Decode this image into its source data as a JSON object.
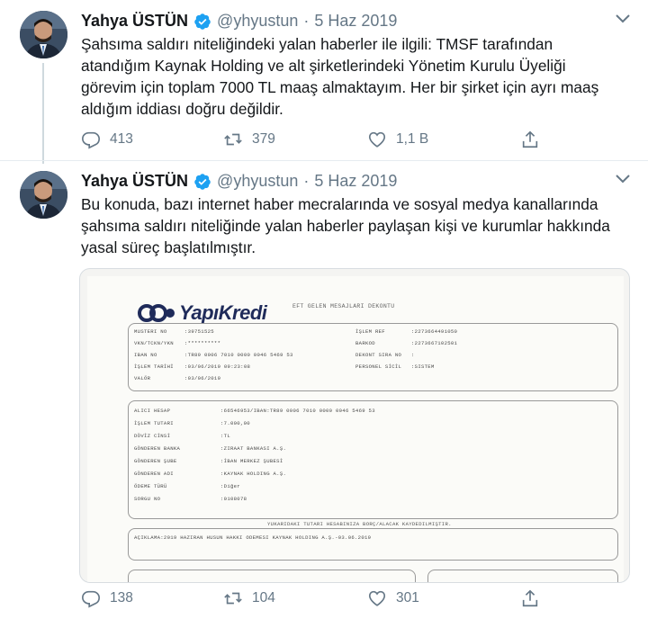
{
  "tweets": [
    {
      "name": "Yahya ÜSTÜN",
      "handle": "@yhyustun",
      "separator": "·",
      "date": "5 Haz 2019",
      "text_lines": [
        "Şahsıma saldırı niteliğindeki yalan haberler ile ilgili: TMSF tarafından",
        "atandığım Kaynak Holding ve alt şirketlerindeki Yönetim Kurulu Üyeliği",
        "görevim için toplam 7000 TL maaş almaktayım. Her bir şirket için ayrı maaş",
        "aldığım iddiası doğru değildir."
      ],
      "replies": "413",
      "retweets": "379",
      "likes": "1,1 B"
    },
    {
      "name": "Yahya ÜSTÜN",
      "handle": "@yhyustun",
      "separator": "·",
      "date": "5 Haz 2019",
      "text_lines": [
        "Bu konuda, bazı internet haber mecralarında ve sosyal medya kanallarında",
        "şahsıma saldırı niteliğinde yalan haberler paylaşan kişi ve kurumlar hakkında",
        "yasal süreç başlatılmıştır."
      ],
      "replies": "138",
      "retweets": "104",
      "likes": "301"
    }
  ],
  "receipt": {
    "logo": "YapıKredi",
    "title": "EFT GELEN MESAJLARI DEKONTU",
    "top_left_labels": [
      "MUSTERI NO",
      "VKN/TCKN/YKN",
      "IBAN NO",
      "İŞLEM TARİHİ",
      "VALÖR"
    ],
    "top_left_values": [
      ":39751525",
      ":**********",
      ":TR89 0006 7010 0000 0046 5469 53",
      ":03/06/2019 09:23:08",
      ":03/06/2019"
    ],
    "top_right_labels": [
      "İŞLEM REF",
      "BARKOD",
      "DEKONT SIRA NO",
      "PERSONEL SİCİL"
    ],
    "top_right_values": [
      ":2273664491050",
      ":2273667102501",
      ":",
      ":SISTEM"
    ],
    "mid_labels": [
      "ALICI HESAP",
      "İŞLEM TUTARI",
      "DÖVİZ CİNSİ",
      "GÖNDEREN BANKA",
      "GÖNDEREN ŞUBE",
      "GÖNDEREN ADI",
      "ÖDEME TÜRÜ",
      "SORGU NO"
    ],
    "mid_values": [
      ":66546953/IBAN:TR89 0006 7010 0000 0046 5469 53",
      ":7.000,00",
      ":TL",
      ":ZIRAAT BANKASI A.Ş.",
      ":İBAN MERKEZ ŞUBESİ",
      ":KAYNAK HOLDING A.Ş.",
      ":Diğer",
      ":0108078"
    ],
    "band_text": "YUKARIDAKI TUTARI HESABINIZA BORÇ/ALACAK KAYDEDILMIŞTIR.",
    "description": "AÇIKLAMA:2019 HAZIRAN HUSUN HAKKI ODEMESI  KAYNAK HOLDING A.Ş.-03.06.2019"
  },
  "icons": {
    "verified": "verified-badge-icon",
    "reply": "reply-icon",
    "retweet": "retweet-icon",
    "like": "heart-icon",
    "share": "share-icon",
    "menu": "chevron-down-icon"
  },
  "colors": {
    "verified": "#1da1f2",
    "muted": "#657786",
    "brand_navy": "#1f2b5a"
  }
}
